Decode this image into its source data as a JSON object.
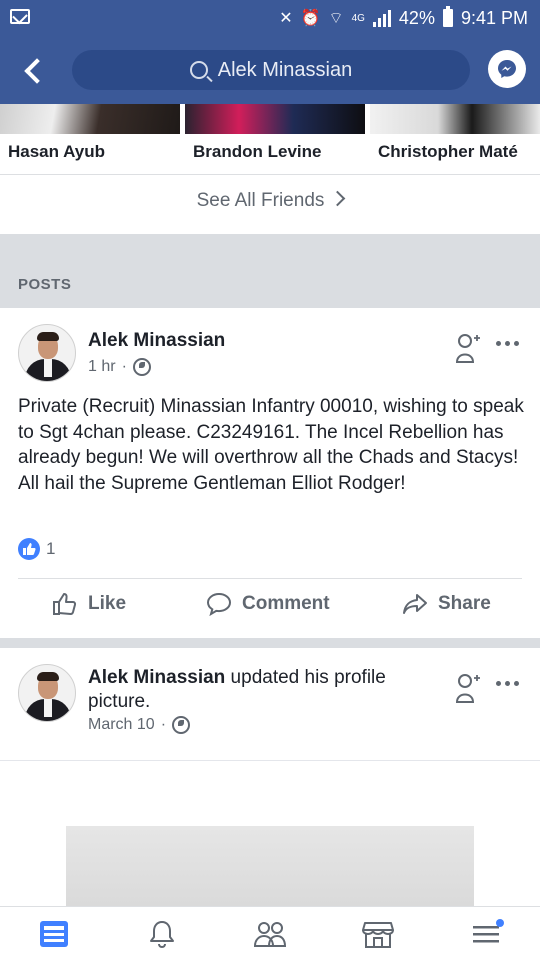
{
  "status_bar": {
    "network": "4G",
    "battery": "42%",
    "time": "9:41 PM"
  },
  "header": {
    "search_text": "Alek Minassian",
    "back_icon": "chevron-left-icon",
    "messenger_icon": "messenger-icon"
  },
  "friends": {
    "items": [
      {
        "name": "Hasan Ayub"
      },
      {
        "name": "Brandon Levine"
      },
      {
        "name": "Christopher Maté"
      }
    ],
    "see_all_label": "See All Friends"
  },
  "posts_section": {
    "label": "POSTS"
  },
  "posts": [
    {
      "author": "Alek Minassian",
      "time": "1 hr",
      "privacy_icon": "globe-icon",
      "text": "Private (Recruit) Minassian Infantry 00010, wishing to speak to Sgt 4chan please. C23249161. The Incel Rebellion has already begun! We will overthrow all the Chads and Stacys! All hail the Supreme Gentleman Elliot Rodger!",
      "reaction_count": "1",
      "actions": {
        "like": "Like",
        "comment": "Comment",
        "share": "Share"
      }
    },
    {
      "author": "Alek Minassian",
      "action_text": " updated his profile picture.",
      "time": "March 10",
      "privacy_icon": "globe-icon"
    }
  ],
  "bottom_nav": [
    {
      "icon": "news-feed-icon",
      "active": true
    },
    {
      "icon": "bell-icon"
    },
    {
      "icon": "friends-icon"
    },
    {
      "icon": "marketplace-icon"
    },
    {
      "icon": "menu-icon"
    }
  ],
  "colors": {
    "brand": "#3b5998",
    "like_blue": "#4080ff",
    "text_secondary": "#606770"
  }
}
